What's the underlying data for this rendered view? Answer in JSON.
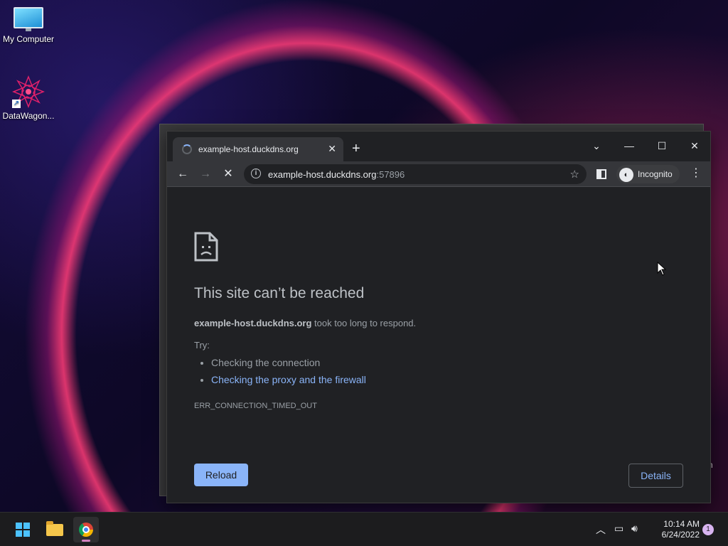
{
  "desktop": {
    "icons": [
      {
        "label": "My Computer",
        "icon": "computer-icon"
      },
      {
        "label": "DataWagon...",
        "icon": "datawagon-shortcut-icon"
      }
    ],
    "background_window_fragment": "n"
  },
  "browser": {
    "tab": {
      "title": "example-host.duckdns.org",
      "icon": "loading-spinner-icon"
    },
    "window_controls": [
      "tab-search",
      "minimize",
      "maximize",
      "close"
    ],
    "address_bar": {
      "host": "example-host.duckdns.org",
      "port": ":57896"
    },
    "profile": {
      "label": "Incognito"
    },
    "error": {
      "title": "This site can’t be reached",
      "host": "example-host.duckdns.org",
      "message": " took too long to respond.",
      "try_label": "Try:",
      "suggestions": [
        "Checking the connection",
        "Checking the proxy and the firewall"
      ],
      "code": "ERR_CONNECTION_TIMED_OUT",
      "reload_label": "Reload",
      "details_label": "Details"
    },
    "colors": {
      "page_bg": "#202124",
      "link": "#8ab4f8",
      "reload_bg": "#8ab4f8"
    }
  },
  "taskbar": {
    "apps": [
      "start-icon",
      "file-explorer-icon",
      "chrome-icon"
    ],
    "clock": {
      "time": "10:14 AM",
      "date": "6/24/2022"
    },
    "notification_count": "1"
  }
}
